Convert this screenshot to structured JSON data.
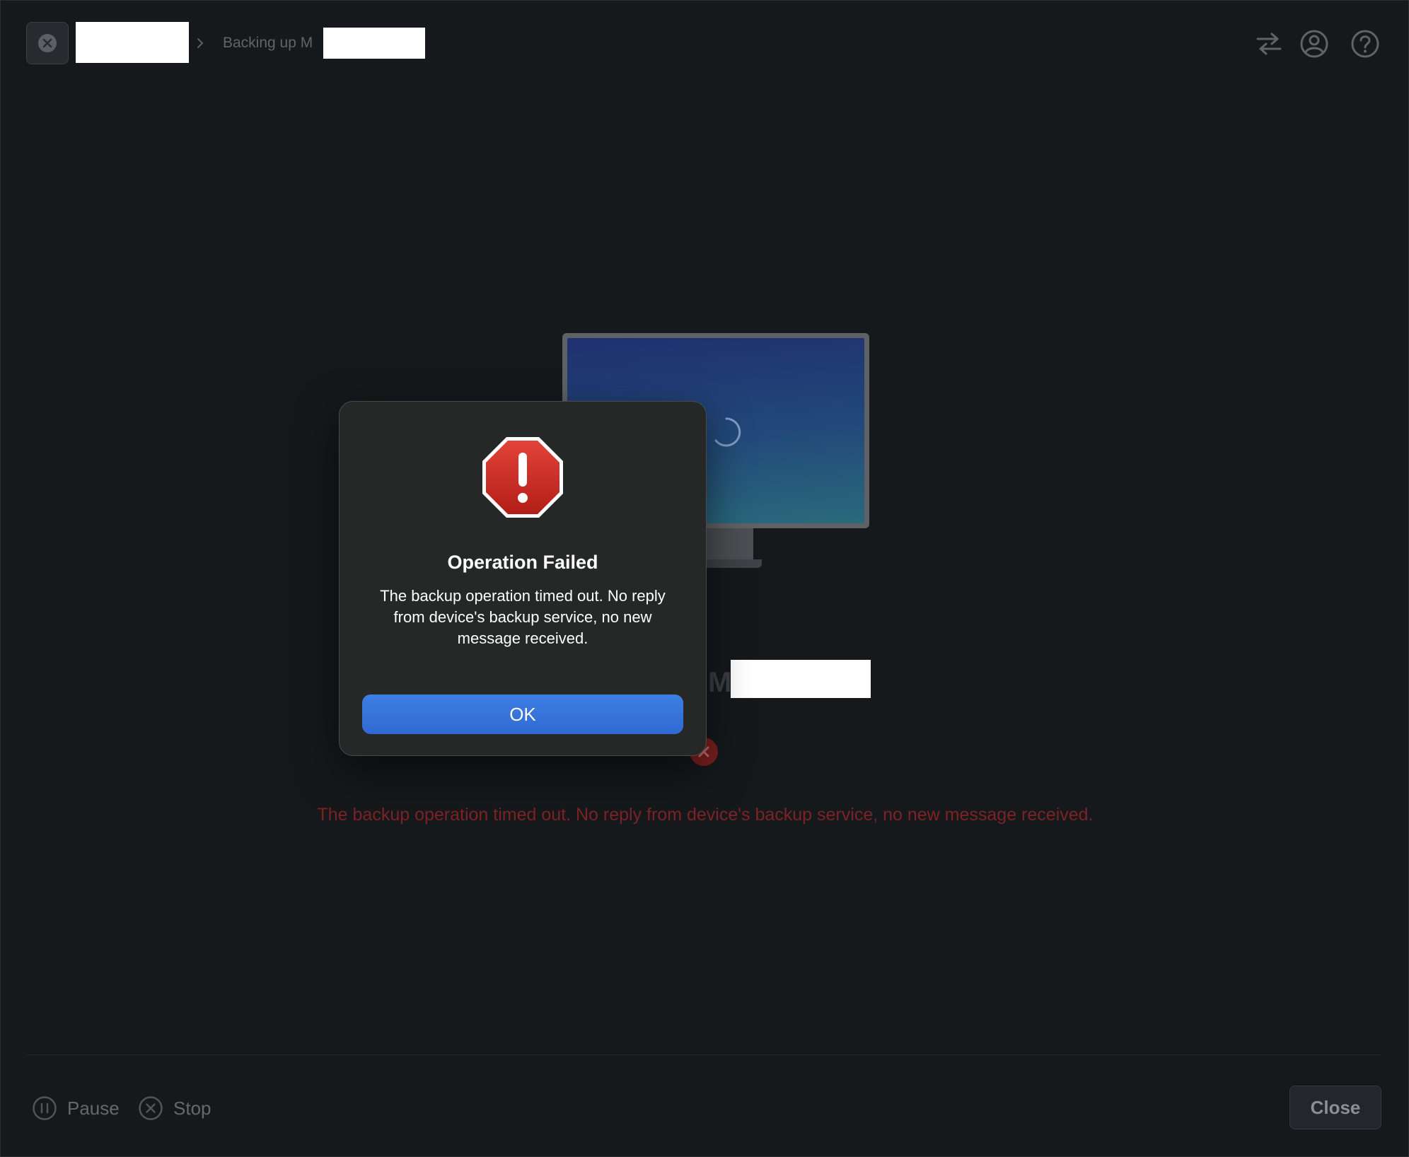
{
  "header": {
    "breadcrumb_current": "Backing up M"
  },
  "main": {
    "device_name_visible": "M",
    "error_message": "The backup operation timed out. No reply from device's backup service, no new message received."
  },
  "footer": {
    "pause_label": "Pause",
    "stop_label": "Stop",
    "close_label": "Close"
  },
  "dialog": {
    "title": "Operation Failed",
    "message": "The backup operation timed out. No reply from device's backup service, no new message received.",
    "ok_label": "OK"
  },
  "colors": {
    "background": "#15191b",
    "error_text": "#7d2225",
    "dialog_ok": "#3478e5",
    "alert_red": "#c8281f"
  },
  "icons": {
    "header": [
      "close-circle-icon",
      "chevron-right-icon"
    ],
    "top_right": [
      "transfer-icon",
      "account-icon",
      "help-icon"
    ],
    "dialog": "stop-alert-icon",
    "footer": [
      "pause-icon",
      "stop-icon"
    ]
  }
}
